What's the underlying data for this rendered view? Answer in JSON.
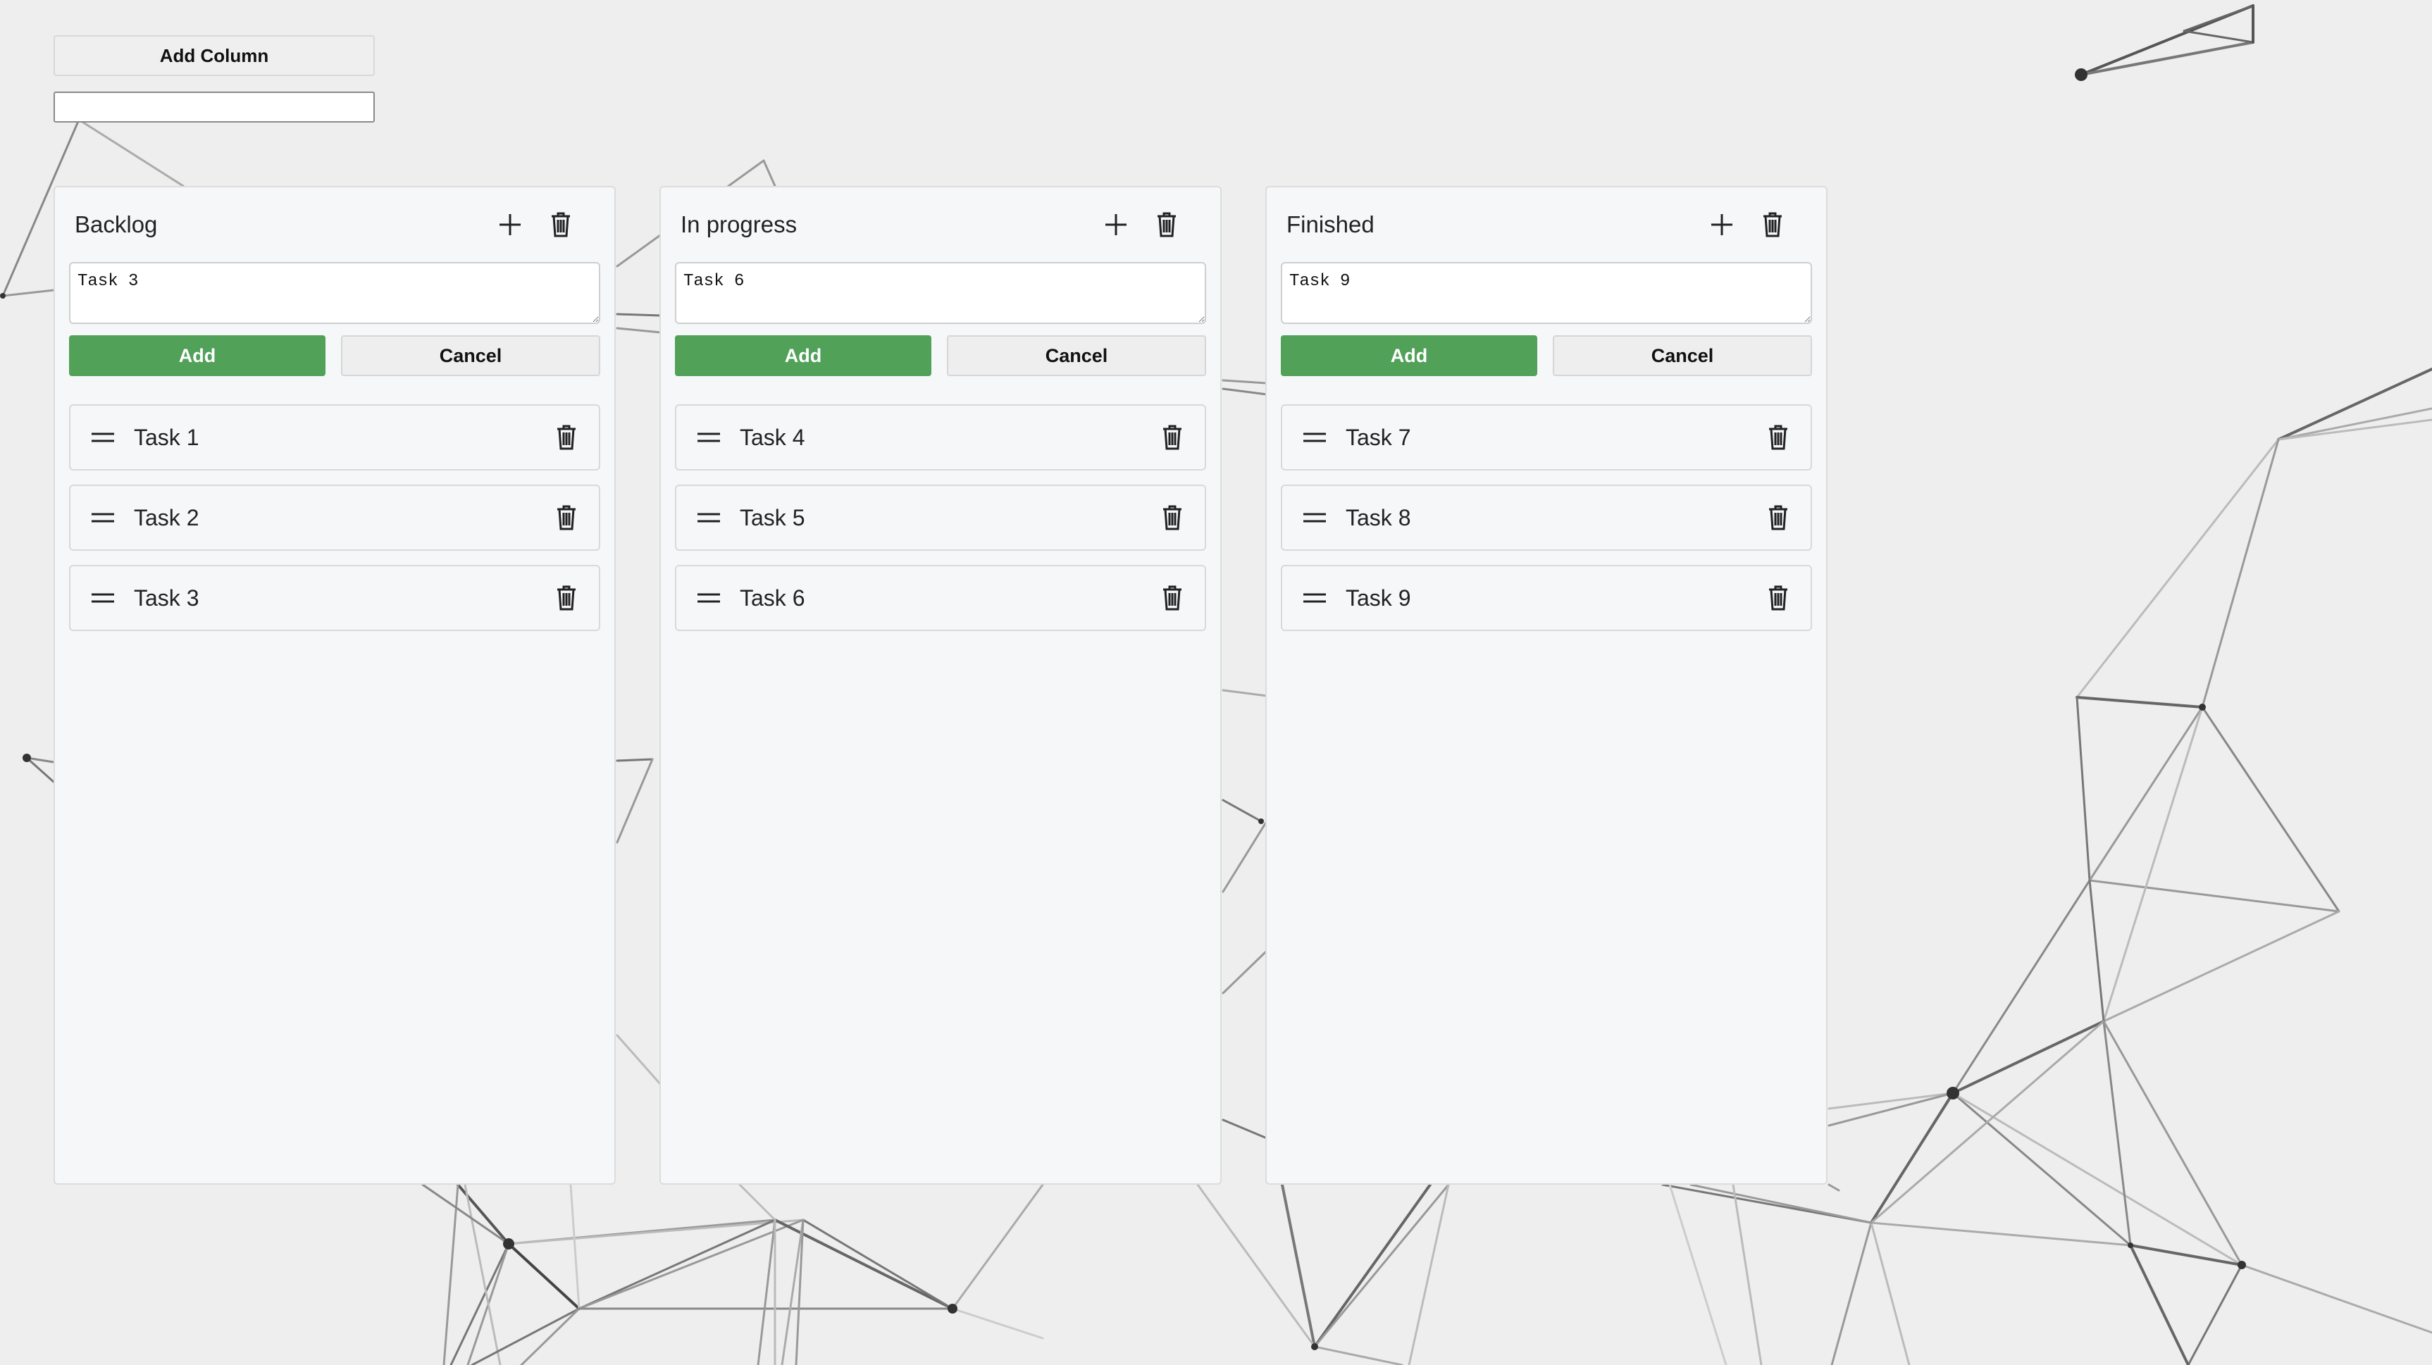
{
  "toolbar": {
    "add_column_label": "Add Column",
    "column_name_value": "",
    "column_name_placeholder": ""
  },
  "actions": {
    "add_label": "Add",
    "cancel_label": "Cancel"
  },
  "icons": {
    "add": "plus-icon",
    "delete": "trash-icon",
    "drag": "drag-handle-icon"
  },
  "colors": {
    "add_button": "#51a159",
    "background": "#eeeeee",
    "column_background": "#f6f7f9"
  },
  "columns": [
    {
      "title": "Backlog",
      "new_task_value": "Task 3",
      "tasks": [
        {
          "label": "Task 1"
        },
        {
          "label": "Task 2"
        },
        {
          "label": "Task 3"
        }
      ]
    },
    {
      "title": "In progress",
      "new_task_value": "Task 6",
      "tasks": [
        {
          "label": "Task 4"
        },
        {
          "label": "Task 5"
        },
        {
          "label": "Task 6"
        }
      ]
    },
    {
      "title": "Finished",
      "new_task_value": "Task 9",
      "tasks": [
        {
          "label": "Task 7"
        },
        {
          "label": "Task 8"
        },
        {
          "label": "Task 9"
        }
      ]
    }
  ]
}
